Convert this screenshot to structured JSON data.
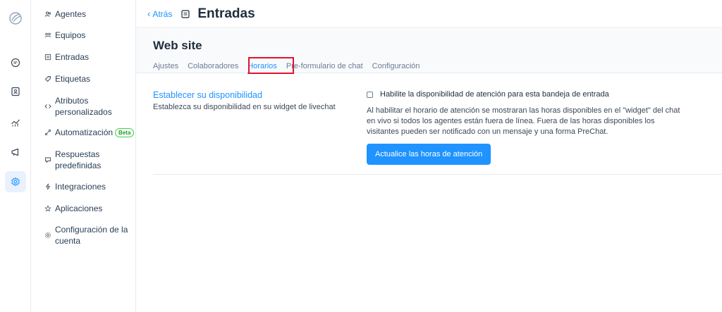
{
  "rail": {
    "items": [
      {
        "icon": "logo-icon"
      },
      {
        "icon": "conversations-icon"
      },
      {
        "icon": "contacts-icon"
      },
      {
        "icon": "reports-icon"
      },
      {
        "icon": "campaigns-icon"
      },
      {
        "icon": "settings-icon",
        "active": true
      }
    ]
  },
  "menu": {
    "items": [
      {
        "label": "Agentes",
        "icon": "agents-icon"
      },
      {
        "label": "Equipos",
        "icon": "teams-icon"
      },
      {
        "label": "Entradas",
        "icon": "inbox-icon"
      },
      {
        "label": "Etiquetas",
        "icon": "tag-icon"
      },
      {
        "label": "Atributos personalizados",
        "icon": "code-icon"
      },
      {
        "label": "Automatización",
        "icon": "automation-icon",
        "badge": "Beta"
      },
      {
        "label": "Respuestas predefinidas",
        "icon": "chat-icon"
      },
      {
        "label": "Integraciones",
        "icon": "flash-icon"
      },
      {
        "label": "Aplicaciones",
        "icon": "apps-icon"
      },
      {
        "label": "Configuración de la cuenta",
        "icon": "gear-icon"
      }
    ]
  },
  "topbar": {
    "back_label": "Atrás",
    "title": "Entradas"
  },
  "inbox": {
    "name": "Web site",
    "tabs": [
      {
        "label": "Ajustes"
      },
      {
        "label": "Colaboradores"
      },
      {
        "label": "Horarios",
        "active": true
      },
      {
        "label": "Pre-formulario de chat"
      },
      {
        "label": "Configuración"
      }
    ]
  },
  "business_hours": {
    "title": "Establecer su disponibilidad",
    "subtitle": "Establezca su disponibilidad en su widget de livechat",
    "checkbox_label": "Habilite la disponibilidad de atención para esta bandeja de entrada",
    "help_text": "Al habilitar el horario de atención se mostraran las horas disponibles en el \"widget\" del chat en vivo si todos los agentes están fuera de línea. Fuera de las horas disponibles los visitantes pueden ser notificado con un mensaje y una forma PreChat.",
    "button_label": "Actualice las horas de atención"
  },
  "colors": {
    "accent": "#1f93ff",
    "highlight": "#e0142d",
    "beta": "#44ce4b"
  }
}
